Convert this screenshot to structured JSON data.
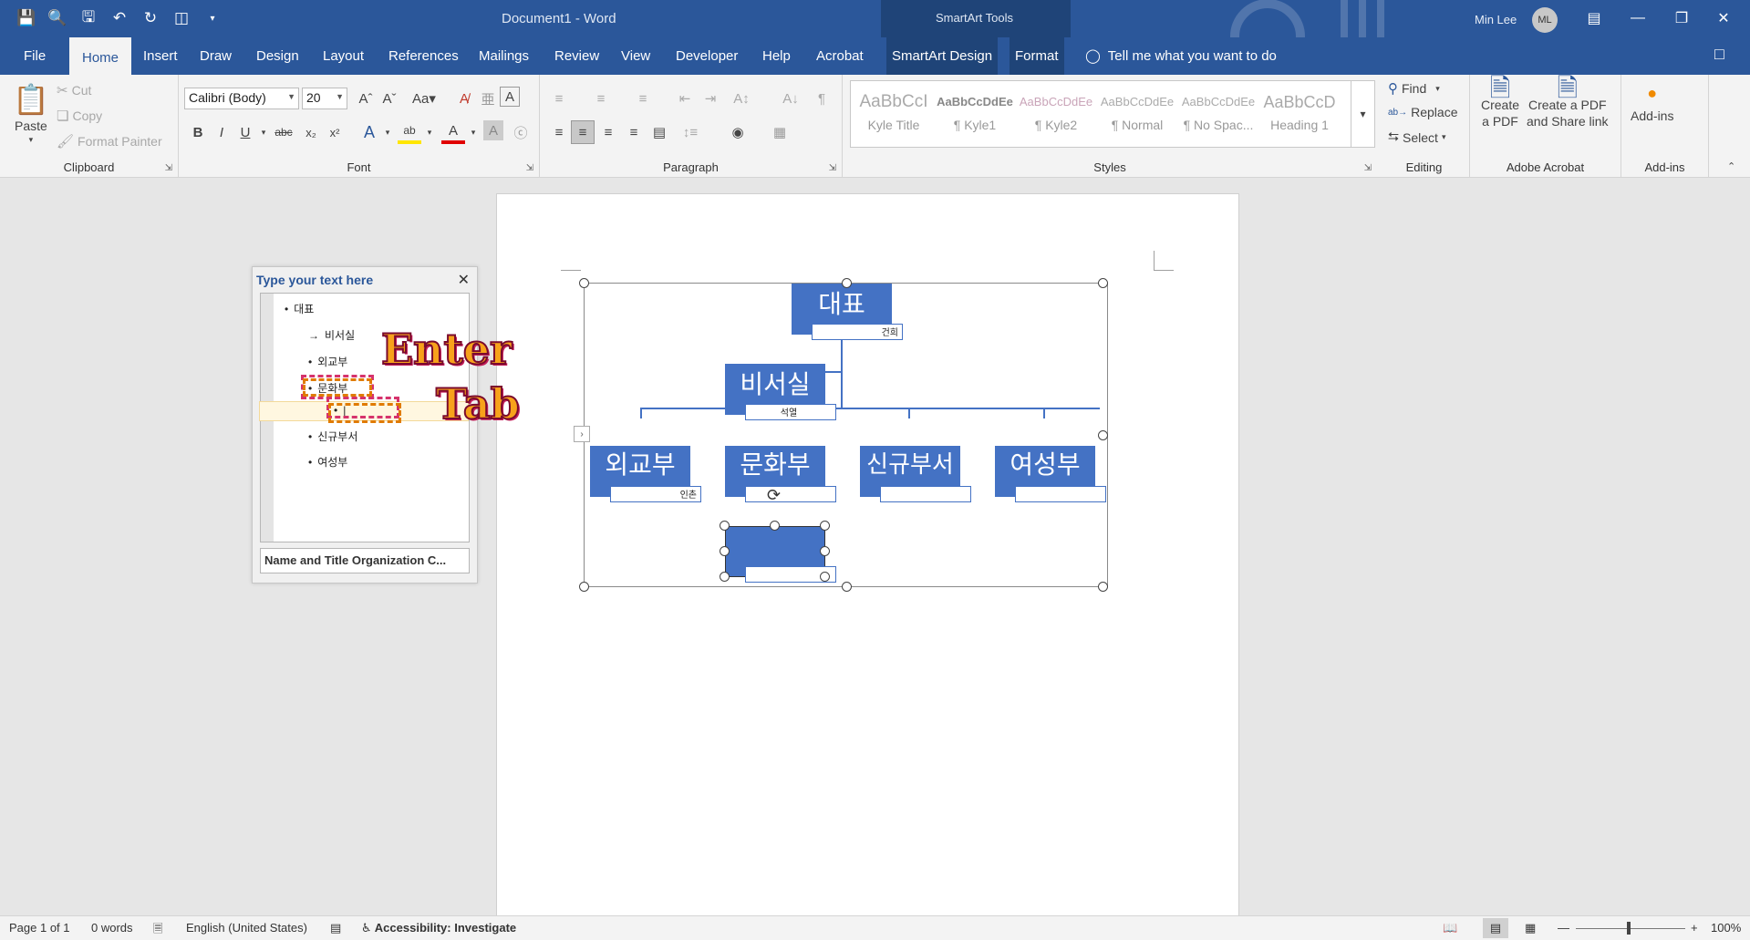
{
  "titlebar": {
    "doc_title": "Document1  -  Word",
    "tools_label": "SmartArt Tools",
    "user_name": "Min Lee",
    "user_initials": "ML",
    "qat": [
      "save-icon",
      "print-preview-icon",
      "save-as-icon",
      "undo-icon",
      "redo-icon",
      "layout-icon",
      "customize-icon"
    ]
  },
  "tabs": [
    {
      "label": "File"
    },
    {
      "label": "Home"
    },
    {
      "label": "Insert"
    },
    {
      "label": "Draw"
    },
    {
      "label": "Design"
    },
    {
      "label": "Layout"
    },
    {
      "label": "References"
    },
    {
      "label": "Mailings"
    },
    {
      "label": "Review"
    },
    {
      "label": "View"
    },
    {
      "label": "Developer"
    },
    {
      "label": "Help"
    },
    {
      "label": "Acrobat"
    },
    {
      "label": "SmartArt Design"
    },
    {
      "label": "Format"
    }
  ],
  "active_tab": "Home",
  "tell_me": "Tell me what you want to do",
  "ribbon": {
    "clipboard": {
      "label": "Clipboard",
      "paste": "Paste",
      "cut": "Cut",
      "copy": "Copy",
      "format_painter": "Format Painter"
    },
    "font": {
      "label": "Font",
      "font_name": "Calibri (Body)",
      "font_size": "20",
      "change_case": "Aa"
    },
    "paragraph": {
      "label": "Paragraph"
    },
    "styles": {
      "label": "Styles",
      "items": [
        {
          "sample": "AaBbCcI",
          "name": "Kyle Title"
        },
        {
          "sample": "AaBbCcDdEe",
          "name": "¶ Kyle1"
        },
        {
          "sample": "AaBbCcDdEe",
          "name": "¶ Kyle2"
        },
        {
          "sample": "AaBbCcDdEe",
          "name": "¶ Normal"
        },
        {
          "sample": "AaBbCcDdEe",
          "name": "¶ No Spac..."
        },
        {
          "sample": "AaBbCcD",
          "name": "Heading 1"
        }
      ]
    },
    "editing": {
      "label": "Editing",
      "find": "Find",
      "replace": "Replace",
      "select": "Select"
    },
    "acrobat": {
      "label": "Adobe Acrobat",
      "create_pdf_1": "Create",
      "create_pdf_2": "a PDF",
      "create_share_1": "Create a PDF",
      "create_share_2": "and Share link"
    },
    "addins": {
      "label": "Add-ins",
      "button": "Add-ins"
    }
  },
  "text_pane": {
    "title": "Type your text here",
    "items": [
      {
        "text": "대표",
        "bullet": "•"
      },
      {
        "text": "비서실",
        "bullet": "→"
      },
      {
        "text": "외교부",
        "bullet": "•"
      },
      {
        "text": "문화부",
        "bullet": "•"
      },
      {
        "text": "",
        "bullet": "•"
      },
      {
        "text": "신규부서",
        "bullet": "•"
      },
      {
        "text": "여성부",
        "bullet": "•"
      }
    ],
    "footer": "Name and Title Organization C..."
  },
  "annotations": {
    "enter": "Enter",
    "tab": "Tab"
  },
  "smartart": {
    "top": {
      "name": "대표",
      "title": "건희"
    },
    "assistant": {
      "name": "비서실",
      "title": "석열"
    },
    "departments": [
      {
        "name": "외교부",
        "title": "인촌"
      },
      {
        "name": "문화부",
        "title": ""
      },
      {
        "name": "신규부서",
        "title": ""
      },
      {
        "name": "여성부",
        "title": ""
      }
    ],
    "new_child": {
      "name": "",
      "title": ""
    },
    "box_color": "#4472c4"
  },
  "statusbar": {
    "page": "Page 1 of 1",
    "words": "0 words",
    "language": "English (United States)",
    "accessibility": "Accessibility: Investigate",
    "zoom": "100%"
  },
  "colors": {
    "word_blue": "#2b579a",
    "ribbon_bg": "#f3f3f3",
    "annotation_red": "#d6336c",
    "annotation_orange": "#e07b00"
  }
}
